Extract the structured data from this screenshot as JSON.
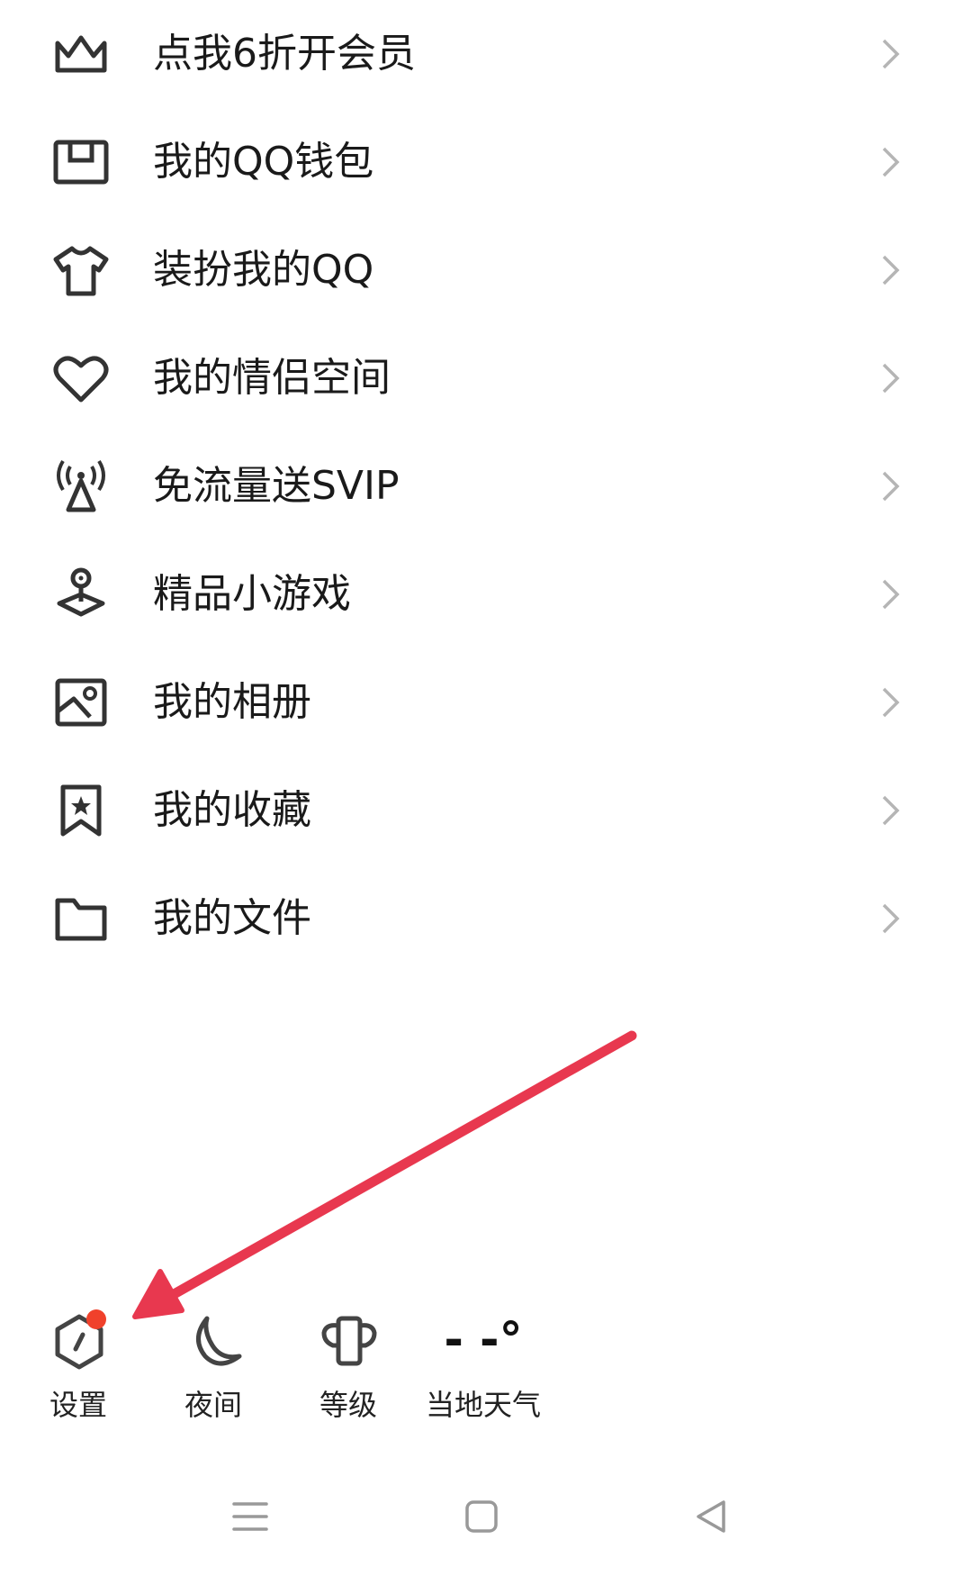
{
  "menu": {
    "items": [
      {
        "icon": "crown-icon",
        "label": "点我6折开会员"
      },
      {
        "icon": "wallet-icon",
        "label": "我的QQ钱包"
      },
      {
        "icon": "tshirt-icon",
        "label": "装扮我的QQ"
      },
      {
        "icon": "heart-icon",
        "label": "我的情侣空间"
      },
      {
        "icon": "signal-tower-icon",
        "label": "免流量送SVIP"
      },
      {
        "icon": "game-joystick-icon",
        "label": "精品小游戏"
      },
      {
        "icon": "photo-album-icon",
        "label": "我的相册"
      },
      {
        "icon": "bookmark-star-icon",
        "label": "我的收藏"
      },
      {
        "icon": "folder-icon",
        "label": "我的文件"
      }
    ]
  },
  "bottom": {
    "settings_label": "设置",
    "night_label": "夜间",
    "level_label": "等级",
    "weather_value": "- -°",
    "weather_label": "当地天气"
  },
  "colors": {
    "annotation_arrow": "#e8384f",
    "badge": "#f0412b",
    "icon": "#333333",
    "chevron": "#b5b5b5"
  }
}
